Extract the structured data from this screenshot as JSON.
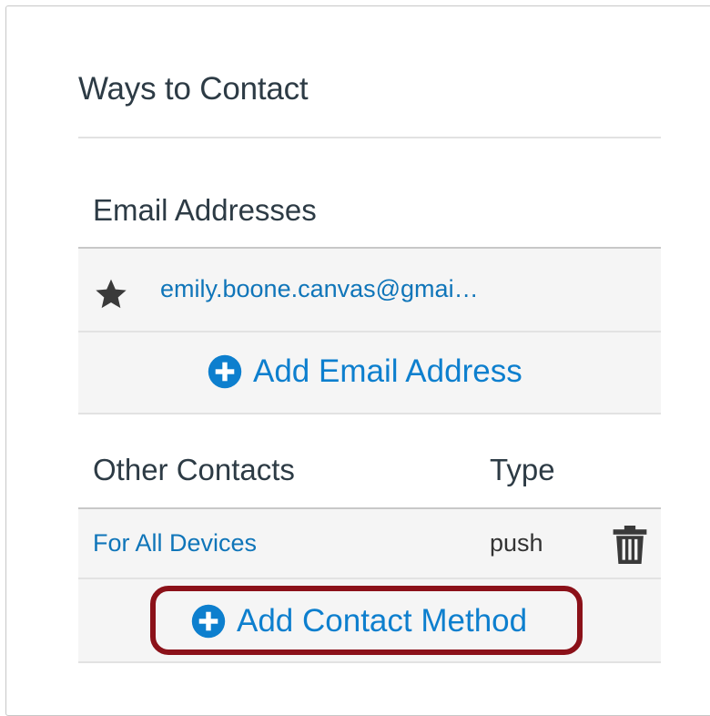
{
  "ways_to_contact": {
    "title": "Ways to Contact"
  },
  "email_section": {
    "heading": "Email Addresses",
    "emails": [
      {
        "address": "emily.boone.canvas@gmai…",
        "icon": "star-icon",
        "default": true
      }
    ],
    "add_label": "Add Email Address"
  },
  "other_contacts": {
    "heading": "Other Contacts",
    "type_heading": "Type",
    "rows": [
      {
        "name": "For All Devices",
        "type": "push",
        "icon": "trash-icon"
      }
    ],
    "add_label": "Add Contact Method"
  },
  "colors": {
    "link": "#0f75b9",
    "add_button": "#0d7fce",
    "highlight_border": "#8b1119",
    "heading_text": "#2d3b45"
  }
}
